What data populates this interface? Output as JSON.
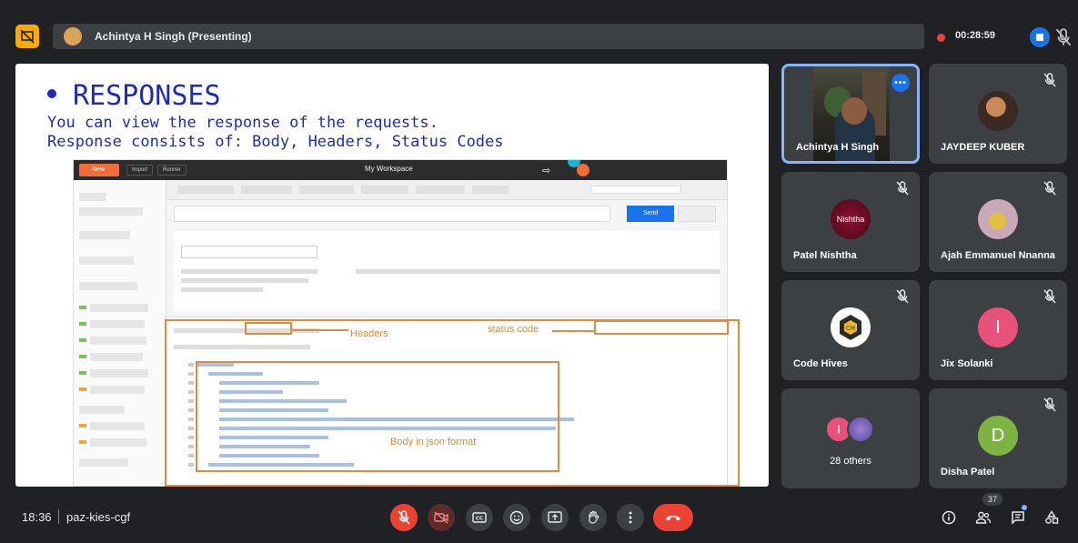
{
  "header": {
    "presenter_label": "Achintya H Singh (Presenting)",
    "recording_time": "00:28:59"
  },
  "slide": {
    "title": "RESPONSES",
    "line1": "You can view the response of the requests.",
    "line2": "Response consists of: Body, Headers, Status Codes",
    "workspace_label": "My Workspace",
    "send_label": "Send",
    "annotations": {
      "headers": "Headers",
      "status_code": "status code",
      "body": "Body in json format"
    }
  },
  "participants": [
    {
      "name": "Achintya H Singh",
      "muted": false,
      "kind": "video"
    },
    {
      "name": "JAYDEEP KUBER",
      "muted": true,
      "kind": "photo"
    },
    {
      "name": "Patel Nishtha",
      "muted": true,
      "kind": "photo",
      "photo_text": "Nishtha"
    },
    {
      "name": "Ajah Emmanuel Nnanna",
      "muted": true,
      "kind": "photo"
    },
    {
      "name": "Code Hives",
      "muted": true,
      "kind": "logo"
    },
    {
      "name": "Jix Solanki",
      "muted": true,
      "kind": "initial",
      "initial": "I",
      "color": "#e8527a"
    },
    {
      "name": "28 others",
      "muted": false,
      "kind": "group",
      "initial": "I"
    },
    {
      "name": "Disha Patel",
      "muted": true,
      "kind": "initial",
      "initial": "D",
      "color": "#7cb342"
    }
  ],
  "footer": {
    "time": "18:36",
    "meeting_code": "paz-kies-cgf",
    "people_count": "37"
  },
  "colors": {
    "background": "#202124",
    "tile": "#3c4043",
    "accent_blue": "#1a73e8",
    "danger_red": "#ea4335",
    "annotation_orange": "#e58a3a",
    "slide_text": "#1f2bb4"
  }
}
